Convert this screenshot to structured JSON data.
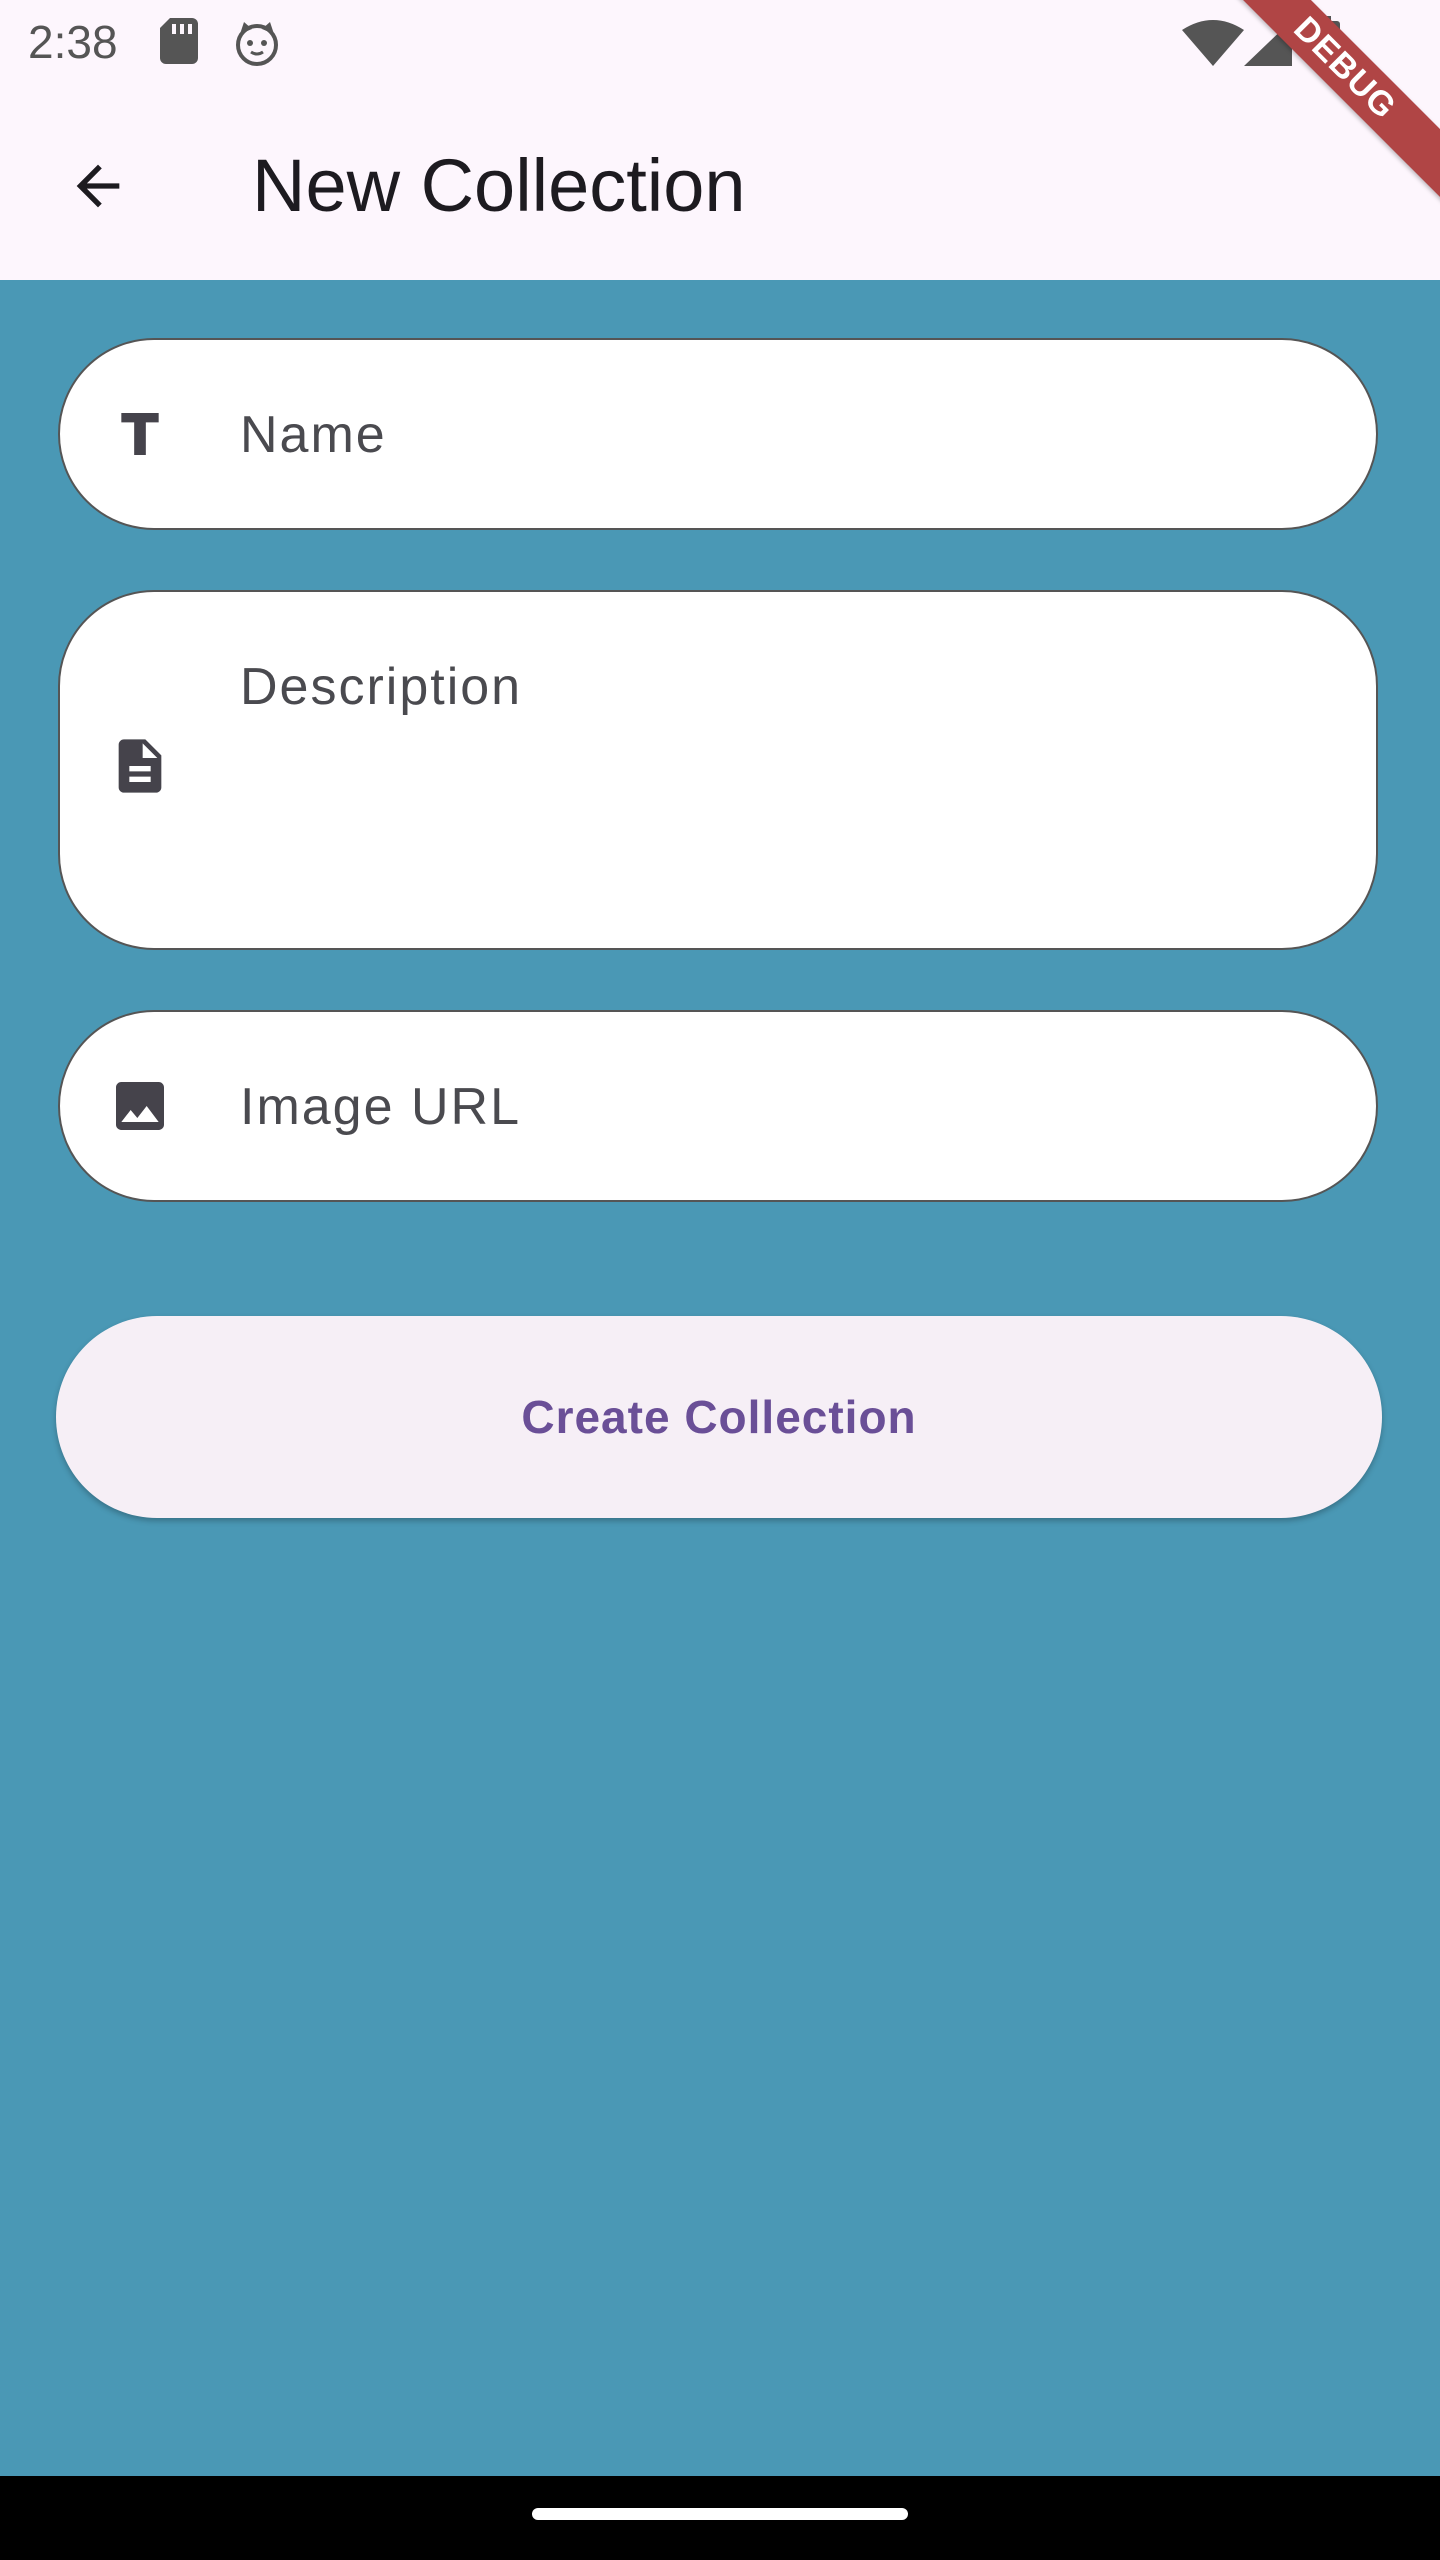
{
  "status_bar": {
    "time": "2:38",
    "icons": [
      "sd-card-icon",
      "cat-icon",
      "wifi-icon",
      "signal-icon",
      "battery-icon"
    ]
  },
  "app_bar": {
    "back_icon": "arrow-back-icon",
    "title": "New Collection",
    "debug_banner": "DEBUG"
  },
  "form": {
    "name": {
      "label": "Name",
      "icon": "text-icon"
    },
    "description": {
      "label": "Description",
      "icon": "document-icon"
    },
    "image_url": {
      "label": "Image URL",
      "icon": "image-icon"
    },
    "submit_label": "Create Collection"
  },
  "colors": {
    "background": "#4a98b5",
    "app_bar": "#fdf6fd",
    "button_bg": "#f6eff6",
    "button_text": "#6a4f97",
    "debug_ribbon": "#b04545"
  }
}
